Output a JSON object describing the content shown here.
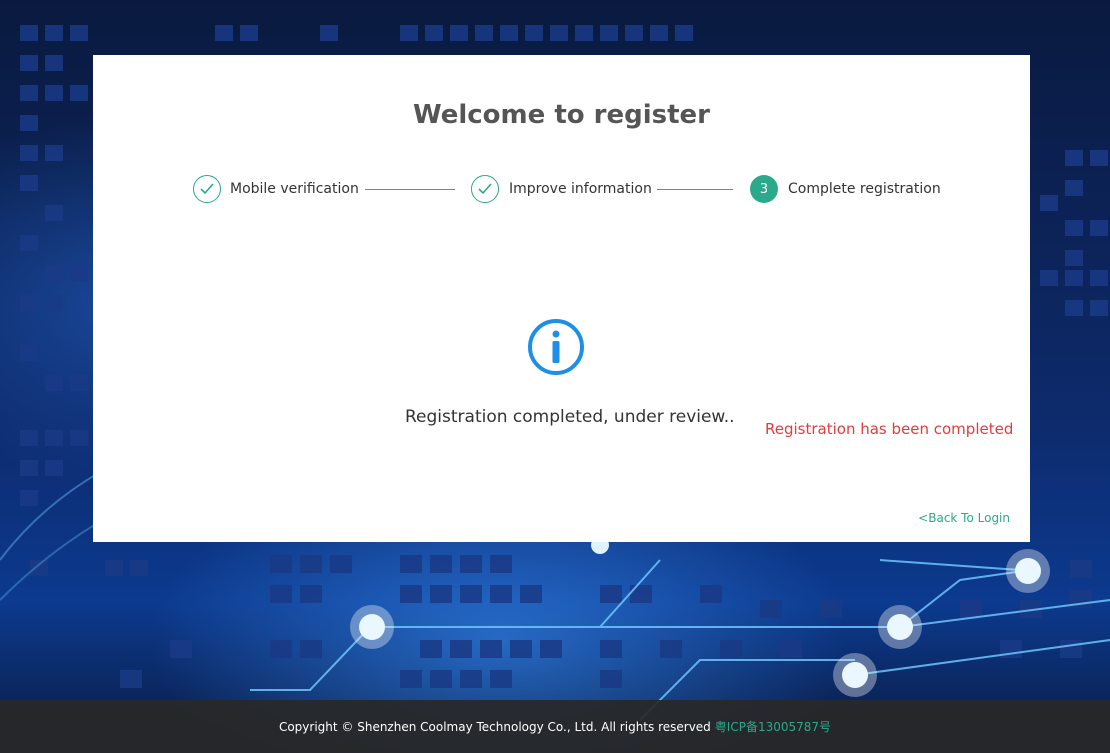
{
  "page": {
    "title": "Welcome to register"
  },
  "steps": [
    {
      "label": "Mobile verification",
      "state": "done",
      "icon": "check-icon"
    },
    {
      "label": "Improve information",
      "state": "done",
      "icon": "check-icon"
    },
    {
      "label": "Complete registration",
      "state": "active",
      "number": "3"
    }
  ],
  "status": {
    "icon": "info-icon",
    "message": "Registration completed, under review..",
    "notice": "Registration has been completed"
  },
  "links": {
    "back_to_login": "<Back To Login"
  },
  "footer": {
    "copyright": "Copyright © Shenzhen Coolmay Technology Co., Ltd. All rights reserved",
    "icp": "粤ICP备13005787号"
  },
  "colors": {
    "accent": "#2aa98b",
    "info_blue": "#1e8fe8",
    "error_red": "#e13d3d"
  }
}
